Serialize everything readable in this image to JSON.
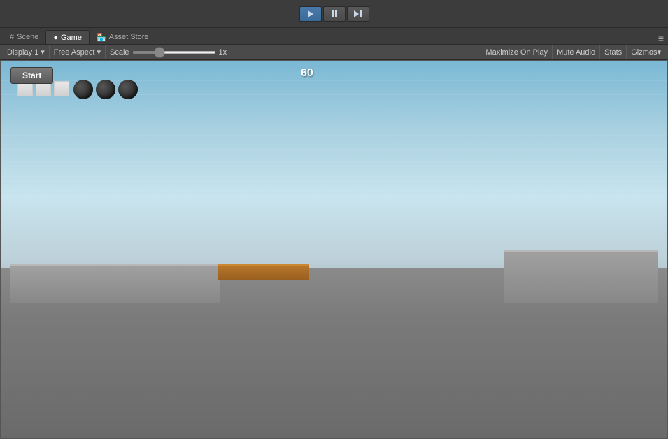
{
  "topbar": {
    "play_label": "▶",
    "pause_label": "⏸",
    "step_label": "⏭"
  },
  "tabs": [
    {
      "id": "scene",
      "label": "Scene",
      "icon": "#",
      "active": false
    },
    {
      "id": "game",
      "label": "Game",
      "icon": "●",
      "active": true
    },
    {
      "id": "asset_store",
      "label": "Asset Store",
      "icon": "🏪",
      "active": false
    }
  ],
  "toolbar": {
    "display_label": "Display 1",
    "aspect_label": "Free Aspect",
    "scale_label": "Scale",
    "scale_value": "1x",
    "maximize_label": "Maximize On Play",
    "mute_label": "Mute Audio",
    "stats_label": "Stats",
    "gizmos_label": "Gizmos"
  },
  "game": {
    "score": "60",
    "start_button": "Start",
    "lives_count": 3,
    "balls_count": 3
  }
}
